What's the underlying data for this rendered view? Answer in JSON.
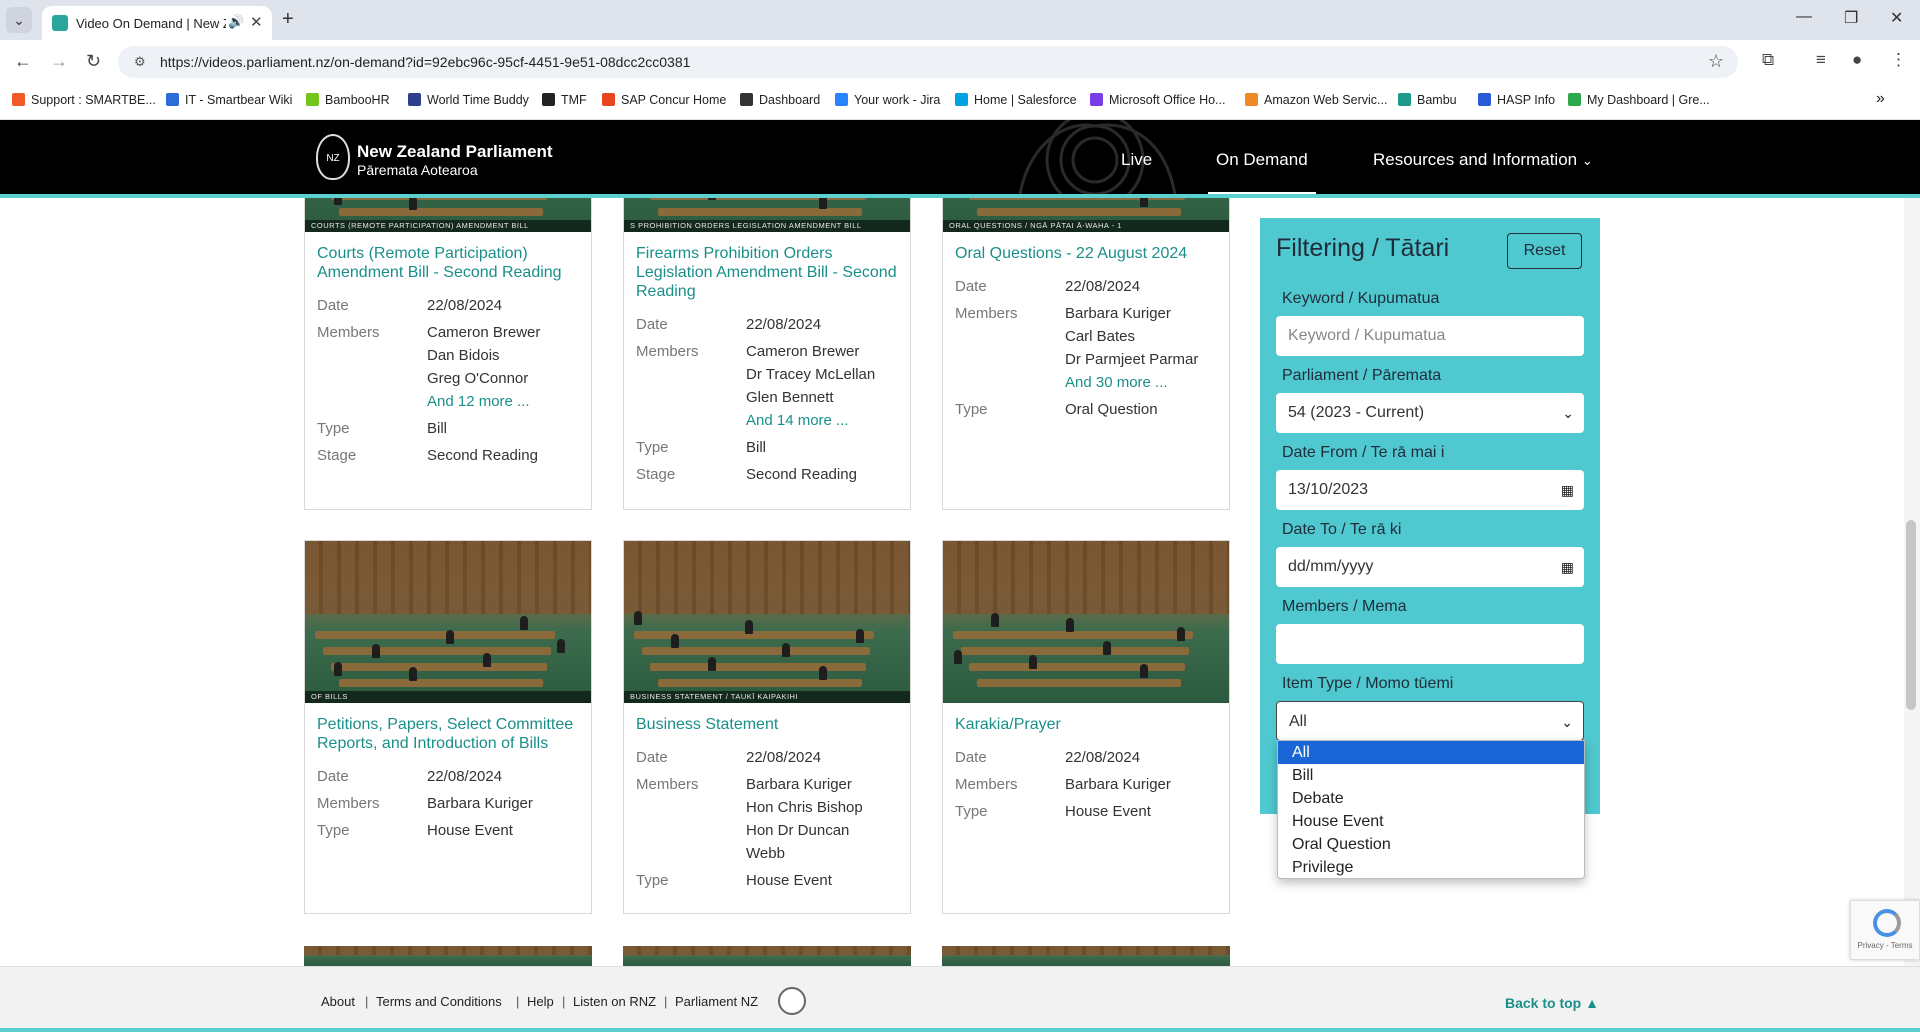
{
  "browser": {
    "tab_title": "Video On Demand | New Ze",
    "url": "https://videos.parliament.nz/on-demand?id=92ebc96c-95cf-4451-9e51-08dcc2cc0381",
    "bookmarks": [
      {
        "label": "Support : SMARTBE...",
        "color": "#f05a28"
      },
      {
        "label": "IT - Smartbear Wiki",
        "color": "#2a6dd9"
      },
      {
        "label": "BambooHR",
        "color": "#73c41d"
      },
      {
        "label": "World Time Buddy",
        "color": "#2f3e8f"
      },
      {
        "label": "TMF",
        "color": "#222222"
      },
      {
        "label": "SAP Concur Home",
        "color": "#e8471d"
      },
      {
        "label": "Dashboard",
        "color": "#333333"
      },
      {
        "label": "Your work - Jira",
        "color": "#2684ff"
      },
      {
        "label": "Home | Salesforce",
        "color": "#00a1e0"
      },
      {
        "label": "Microsoft Office Ho...",
        "color": "#7a3ee8"
      },
      {
        "label": "Amazon Web Servic...",
        "color": "#f08a24"
      },
      {
        "label": "Bambu",
        "color": "#1b9a8a"
      },
      {
        "label": "HASP Info",
        "color": "#2a5bd7"
      },
      {
        "label": "My Dashboard | Gre...",
        "color": "#2aa84a"
      }
    ]
  },
  "site": {
    "title": "New Zealand Parliament",
    "subtitle": "Pāremata Aotearoa",
    "nav": {
      "live": "Live",
      "on_demand": "On Demand",
      "resources": "Resources and Information"
    }
  },
  "labels": {
    "date": "Date",
    "members": "Members",
    "type": "Type",
    "stage": "Stage"
  },
  "cards_top": [
    {
      "caption": "COURTS (REMOTE PARTICIPATION) AMENDMENT BILL",
      "title": "Courts (Remote Participation) Amendment Bill - Second Reading",
      "date": "22/08/2024",
      "members": [
        "Cameron Brewer",
        "Dan Bidois",
        "Greg O'Connor"
      ],
      "more": "And 12 more ...",
      "type": "Bill",
      "stage": "Second Reading"
    },
    {
      "caption": "S PROHIBITION ORDERS LEGISLATION AMENDMENT BILL",
      "title": "Firearms Prohibition Orders Legislation Amendment Bill - Second Reading",
      "date": "22/08/2024",
      "members": [
        "Cameron Brewer",
        "Dr Tracey McLellan",
        "Glen Bennett"
      ],
      "more": "And 14 more ...",
      "type": "Bill",
      "stage": "Second Reading"
    },
    {
      "caption": "ORAL QUESTIONS / NGĀ PĀTAI Ā-WAHA - 1",
      "title": "Oral Questions - 22 August 2024",
      "date": "22/08/2024",
      "members": [
        "Barbara Kuriger",
        "Carl Bates",
        "Dr Parmjeet Parmar"
      ],
      "more": "And 30 more ...",
      "type": "Oral Question"
    }
  ],
  "cards_mid": [
    {
      "caption": "OF BILLS",
      "title": "Petitions, Papers, Select Committee Reports, and Introduction of Bills",
      "date": "22/08/2024",
      "members": [
        "Barbara Kuriger"
      ],
      "type": "House Event"
    },
    {
      "caption": "BUSINESS STATEMENT / TAUKĪ KAIPAKIHI",
      "title": "Business Statement",
      "date": "22/08/2024",
      "members": [
        "Barbara Kuriger",
        "Hon Chris Bishop",
        "Hon Dr Duncan",
        "Webb"
      ],
      "type": "House Event"
    },
    {
      "caption": "",
      "title": "Karakia/Prayer",
      "date": "22/08/2024",
      "members": [
        "Barbara Kuriger"
      ],
      "type": "House Event"
    }
  ],
  "filter": {
    "heading": "Filtering / Tātari",
    "reset": "Reset",
    "keyword_label": "Keyword / Kupumatua",
    "keyword_placeholder": "Keyword / Kupumatua",
    "parliament_label": "Parliament / Pāremata",
    "parliament_value": "54 (2023 - Current)",
    "date_from_label": "Date From / Te rā mai i",
    "date_from_value": "13/10/2023",
    "date_to_label": "Date To / Te rā ki",
    "date_to_value": "dd/mm/yyyy",
    "members_label": "Members / Mema",
    "members_value": "",
    "item_type_label": "Item Type / Momo tūemi",
    "item_type_value": "All",
    "item_type_options": [
      "All",
      "Bill",
      "Debate",
      "House Event",
      "Oral Question",
      "Privilege"
    ]
  },
  "footer": {
    "links": [
      "About",
      "Terms and Conditions",
      "Help",
      "Listen on RNZ",
      "Parliament NZ"
    ],
    "back_to_top": "Back to top ▲"
  },
  "recaptcha": {
    "text": "Privacy - Terms"
  },
  "colors": {
    "accent": "#1a8f8a",
    "filter_bg": "#4fc8d0",
    "header_bg": "#000000",
    "teal_line": "#5ccfcf"
  }
}
